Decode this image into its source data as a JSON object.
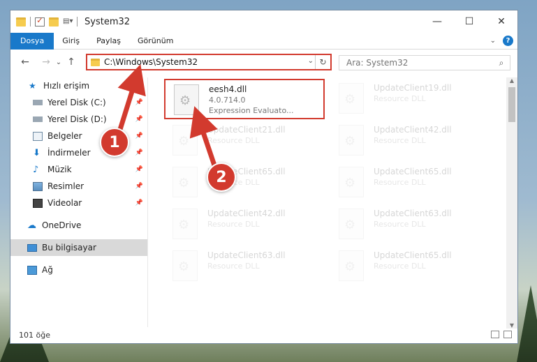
{
  "window": {
    "title": "System32",
    "controls": [
      "—",
      "☐",
      "✕"
    ]
  },
  "ribbon": {
    "tabs": [
      "Dosya",
      "Giriş",
      "Paylaş",
      "Görünüm"
    ],
    "active_tab": "Dosya",
    "help": "?"
  },
  "nav": {
    "back": "←",
    "forward": "→",
    "recent": "⌄",
    "up": "↑",
    "address": "C:\\Windows\\System32",
    "address_chevron": "⌄",
    "refresh": "↻",
    "search_placeholder": "Ara: System32",
    "search_icon": "⌕"
  },
  "sidebar": {
    "items": [
      {
        "label": "Hızlı erişim",
        "icon": "star-icon"
      },
      {
        "label": "Yerel Disk (C:)",
        "icon": "drive-icon"
      },
      {
        "label": "Yerel Disk (D:)",
        "icon": "drive-icon"
      },
      {
        "label": "Belgeler",
        "icon": "documents-icon"
      },
      {
        "label": "İndirmeler",
        "icon": "download-icon"
      },
      {
        "label": "Müzik",
        "icon": "music-icon"
      },
      {
        "label": "Resimler",
        "icon": "pictures-icon"
      },
      {
        "label": "Videolar",
        "icon": "videos-icon"
      },
      {
        "label": "OneDrive",
        "icon": "cloud-icon"
      },
      {
        "label": "Bu bilgisayar",
        "icon": "computer-icon"
      },
      {
        "label": "Ağ",
        "icon": "network-icon"
      }
    ],
    "pin": "📌"
  },
  "files": [
    {
      "name": "eesh4.dll",
      "version": "4.0.714.0",
      "desc": "Expression Evaluato...",
      "highlighted": true
    },
    {
      "name": "UpdateClient19.dll",
      "desc": "Resource DLL"
    },
    {
      "name": "UpdateClient21.dll",
      "desc": "Resource DLL"
    },
    {
      "name": "UpdateClient42.dll",
      "desc": "Resource DLL"
    },
    {
      "name": "UpdateClient65.dll",
      "desc": "Resource DLL"
    },
    {
      "name": "UpdateClient65.dll",
      "desc": "Resource DLL"
    },
    {
      "name": "UpdateClient42.dll",
      "desc": "Resource DLL"
    },
    {
      "name": "UpdateClient63.dll",
      "desc": "Resource DLL"
    },
    {
      "name": "UpdateClient63.dll",
      "desc": "Resource DLL"
    },
    {
      "name": "UpdateClient65.dll",
      "desc": "Resource DLL"
    }
  ],
  "status": {
    "count": "101 öğe"
  },
  "annotations": {
    "step1": "1",
    "step2": "2"
  },
  "colors": {
    "accent": "#1979ca",
    "highlight": "#d23a2e"
  }
}
